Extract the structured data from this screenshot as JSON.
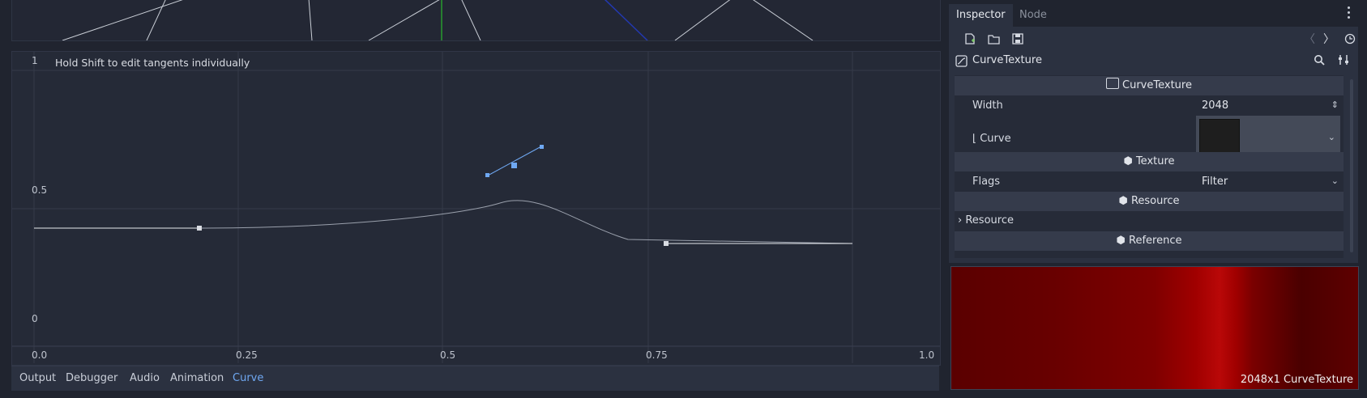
{
  "curve_editor": {
    "hint": "Hold Shift to edit tangents individually",
    "y_labels": {
      "top": "1",
      "mid": "0.5",
      "bottom": "0"
    },
    "x_labels": [
      "0.0",
      "0.25",
      "0.5",
      "0.75",
      "1.0"
    ],
    "points": [
      {
        "x": 0.2,
        "y": 0.42
      },
      {
        "x": 0.58,
        "y": 0.68
      },
      {
        "x": 0.77,
        "y": 0.37
      }
    ]
  },
  "bottom_tabs": [
    {
      "label": "Output"
    },
    {
      "label": "Debugger"
    },
    {
      "label": "Audio"
    },
    {
      "label": "Animation"
    },
    {
      "label": "Curve",
      "active": true
    }
  ],
  "dock": {
    "tabs": [
      {
        "label": "Inspector",
        "active": true
      },
      {
        "label": "Node"
      }
    ],
    "toolbar_icons": [
      "new-resource-icon",
      "open-folder-icon",
      "save-icon",
      "history-back-icon",
      "history-forward-icon",
      "history-icon"
    ],
    "object_name": "CurveTexture",
    "properties": {
      "section_curvetexture": "CurveTexture",
      "width_label": "Width",
      "width_value": "2048",
      "curve_label": "Curve",
      "section_texture": "Texture",
      "flags_label": "Flags",
      "flags_value": "Filter",
      "section_resource": "Resource",
      "resource_label": "Resource",
      "section_reference": "Reference"
    },
    "preview_caption": "2048x1 CurveTexture"
  },
  "colors": {
    "accent": "#6fa8f2",
    "panel_bg": "#252a37",
    "dock_bg": "#2b3140",
    "gradient_peak": "#b90808"
  }
}
